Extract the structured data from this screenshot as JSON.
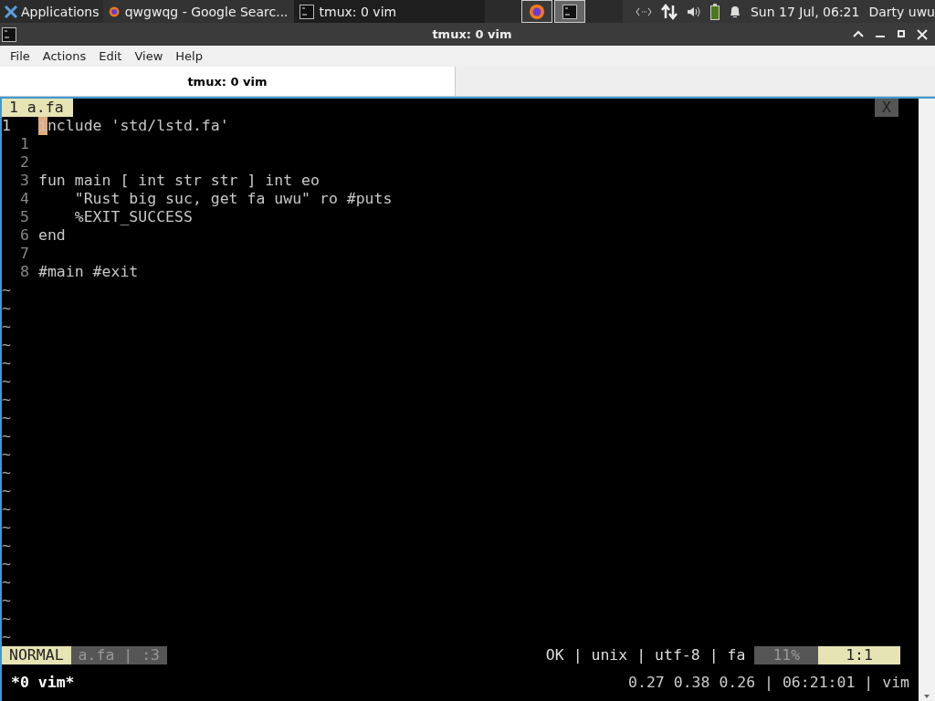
{
  "taskbar": {
    "menu_label": "Applications",
    "tasks": [
      {
        "title": "qwgwqg - Google Searc...",
        "kind": "browser",
        "selected": false
      },
      {
        "title": "tmux: 0 vim",
        "kind": "terminal",
        "selected": true
      }
    ],
    "launchers": [
      {
        "kind": "browser"
      },
      {
        "kind": "terminal"
      }
    ],
    "clock": "Sun 17 Jul, 06:21",
    "user": "Darty uwu"
  },
  "window": {
    "title": "tmux: 0 vim"
  },
  "menu": [
    "File",
    "Actions",
    "Edit",
    "View",
    "Help"
  ],
  "tabs": [
    {
      "label": "tmux: 0 vim",
      "selected": true
    }
  ],
  "vim": {
    "tabline": {
      "tab": "1 a.fa",
      "close": "X"
    },
    "lines": [
      {
        "number": "1",
        "current": true,
        "text": "include 'std/lstd.fa'"
      },
      {
        "number": "1",
        "current": false
      },
      {
        "number": "2",
        "current": false
      },
      {
        "number": "3",
        "current": false,
        "text": "fun main [ int str str ] int eo"
      },
      {
        "number": "4",
        "current": false,
        "text": "    \"Rust big suc, get fa uwu\" ro #puts"
      },
      {
        "number": "5",
        "current": false,
        "text": "    %EXIT_SUCCESS"
      },
      {
        "number": "6",
        "current": false,
        "text": "end"
      },
      {
        "number": "7",
        "current": false
      },
      {
        "number": "8",
        "current": false,
        "text": "#main #exit"
      }
    ],
    "filler": [
      "~",
      "~",
      "~",
      "~",
      "~",
      "~",
      "~",
      "~",
      "~",
      "~",
      "~",
      "~",
      "~",
      "~",
      "~",
      "~",
      "~",
      "~",
      "~",
      "~"
    ],
    "statusline": {
      "mode": "NORMAL",
      "file": "a.fa | :3",
      "info": "OK | unix | utf-8 | fa",
      "percent": "11%",
      "position": "1:1"
    }
  },
  "tmux": {
    "window": "*0 vim*",
    "status": "0.27 0.38 0.26 | 06:21:01 | vim"
  }
}
